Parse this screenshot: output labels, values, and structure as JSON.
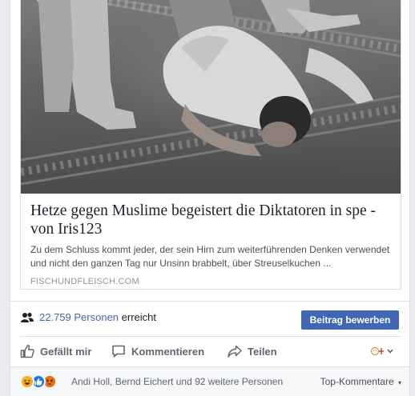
{
  "link_preview": {
    "title": "Hetze gegen Muslime begeistert die Diktatoren in spe - von Iris123",
    "description": "Zu dem Schluss kommt jeder, der sein Hirn zum weiterführenden Denken verwendet und nicht den ganzen Tag nur Unsinn brabbelt, über Streuselkuchen ...",
    "domain": "FISCHUNDFLEISCH.COM"
  },
  "reach": {
    "icon": "people-icon",
    "count_text": "22.759 Personen",
    "suffix": "erreicht",
    "boost_label": "Beitrag bewerben",
    "accent": "#4267b2"
  },
  "actions": {
    "like_label": "Gefällt mir",
    "comment_label": "Kommentieren",
    "share_label": "Teilen",
    "like_icon": "thumbs-up-icon",
    "comment_icon": "comment-bubble-icon",
    "share_icon": "share-arrow-icon",
    "menu_icon": "reaction-menu-icon"
  },
  "reactions": {
    "icons": [
      "haha-icon",
      "like-icon",
      "angry-icon"
    ],
    "text": "Andi Holl, Bernd Eichert und 92 weitere Personen",
    "sort_label": "Top-Kommentare",
    "sort_icon": "caret-down-icon"
  }
}
